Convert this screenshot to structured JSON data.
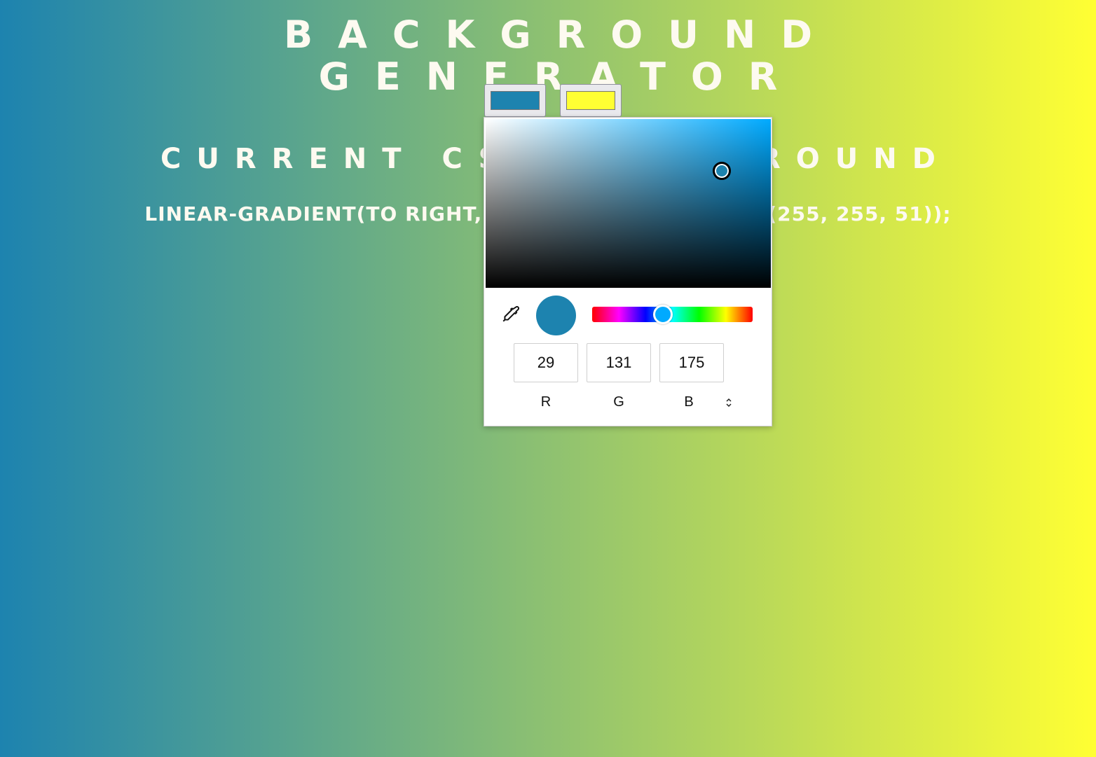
{
  "page": {
    "title": "Background Generator",
    "subtitle": "Current CSS Background",
    "css_output": "linear-gradient(to right, rgb(29, 131, 175), rgb(255, 255, 51));"
  },
  "colors": {
    "color1": "#1d83af",
    "color2": "#ffff33"
  },
  "picker": {
    "rgb": {
      "r": "29",
      "g": "131",
      "b": "175"
    },
    "labels": {
      "r": "R",
      "g": "G",
      "b": "B"
    },
    "hue_color": "#00aaff",
    "icons": {
      "eyedropper": "eyedropper-icon",
      "mode_toggle": "chevron-up-down-icon"
    }
  }
}
